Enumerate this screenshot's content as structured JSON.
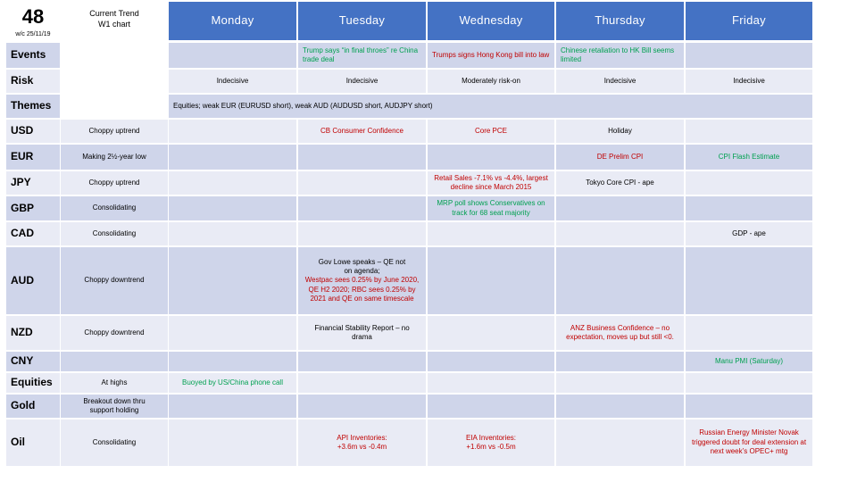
{
  "week": {
    "number": "48",
    "date": "w/c 25/11/19"
  },
  "trend_header": [
    "Current Trend",
    "W1 chart"
  ],
  "days": [
    "Monday",
    "Tuesday",
    "Wednesday",
    "Thursday",
    "Friday"
  ],
  "colors": {
    "header": "#4472c4",
    "row_dark": "#cfd5ea",
    "row_light": "#e9ebf5",
    "negative": "#c00000",
    "positive": "#00a050"
  },
  "rows": {
    "events": {
      "label": "Events",
      "trend": "",
      "mon": "",
      "tue": "Trump says “in final throes” re China trade deal",
      "wed": "Trumps signs Hong Kong bill into law",
      "thu": "Chinese retaliation to HK Bill seems limited",
      "fri": ""
    },
    "risk": {
      "label": "Risk",
      "trend": "",
      "mon": "Indecisive",
      "tue": "Indecisive",
      "wed": "Moderately risk-on",
      "thu": "Indecisive",
      "fri": "Indecisive"
    },
    "themes": {
      "label": "Themes",
      "trend": "",
      "text": "Equities; weak EUR (EURUSD short), weak AUD (AUDUSD short, AUDJPY short)"
    },
    "usd": {
      "label": "USD",
      "trend": "Choppy uptrend",
      "mon": "",
      "tue": "CB Consumer Confidence",
      "wed": "Core PCE",
      "thu": "Holiday",
      "fri": ""
    },
    "eur": {
      "label": "EUR",
      "trend": "Making 2½-year low",
      "mon": "",
      "tue": "",
      "wed": "",
      "thu": "DE Prelim CPI",
      "fri": "CPI Flash Estimate"
    },
    "jpy": {
      "label": "JPY",
      "trend": "Choppy uptrend",
      "mon": "",
      "tue": "",
      "wed": "Retail Sales -7.1% vs -4.4%, largest decline since March 2015",
      "thu": "Tokyo Core CPI - ape",
      "fri": ""
    },
    "gbp": {
      "label": "GBP",
      "trend": "Consolidating",
      "mon": "",
      "tue": "",
      "wed": "MRP poll shows Conservatives on track for 68 seat majority",
      "thu": "",
      "fri": ""
    },
    "cad": {
      "label": "CAD",
      "trend": "Consolidating",
      "mon": "",
      "tue": "",
      "wed": "",
      "thu": "",
      "fri": "GDP - ape"
    },
    "aud": {
      "label": "AUD",
      "trend": "Choppy downtrend",
      "mon": "",
      "tue_a": "Gov Lowe speaks – QE not on agenda;",
      "tue_b": "Westpac sees 0.25% by June 2020, QE H2 2020; RBC sees 0.25% by 2021 and QE on same timescale",
      "wed": "",
      "thu": "",
      "fri": ""
    },
    "nzd": {
      "label": "NZD",
      "trend": "Choppy downtrend",
      "mon": "",
      "tue": "Financial Stability Report – no drama",
      "wed": "",
      "thu": "ANZ Business Confidence – no expectation, moves up but still <0.",
      "fri": ""
    },
    "cny": {
      "label": "CNY",
      "trend": "",
      "mon": "",
      "tue": "",
      "wed": "",
      "thu": "",
      "fri": "Manu PMI (Saturday)"
    },
    "equities": {
      "label": "Equities",
      "trend": "At highs",
      "mon": "Buoyed by US/China phone call",
      "tue": "",
      "wed": "",
      "thu": "",
      "fri": ""
    },
    "gold": {
      "label": "Gold",
      "trend": "Breakout down thru support holding",
      "mon": "",
      "tue": "",
      "wed": "",
      "thu": "",
      "fri": ""
    },
    "oil": {
      "label": "Oil",
      "trend": "Consolidating",
      "mon": "",
      "tue": "API Inventories: +3.6m vs -0.4m",
      "wed": "EIA Inventories: +1.6m vs -0.5m",
      "thu": "",
      "fri": "Russian Energy Minister Novak triggered doubt for deal extension at next week’s OPEC+ mtg"
    }
  }
}
